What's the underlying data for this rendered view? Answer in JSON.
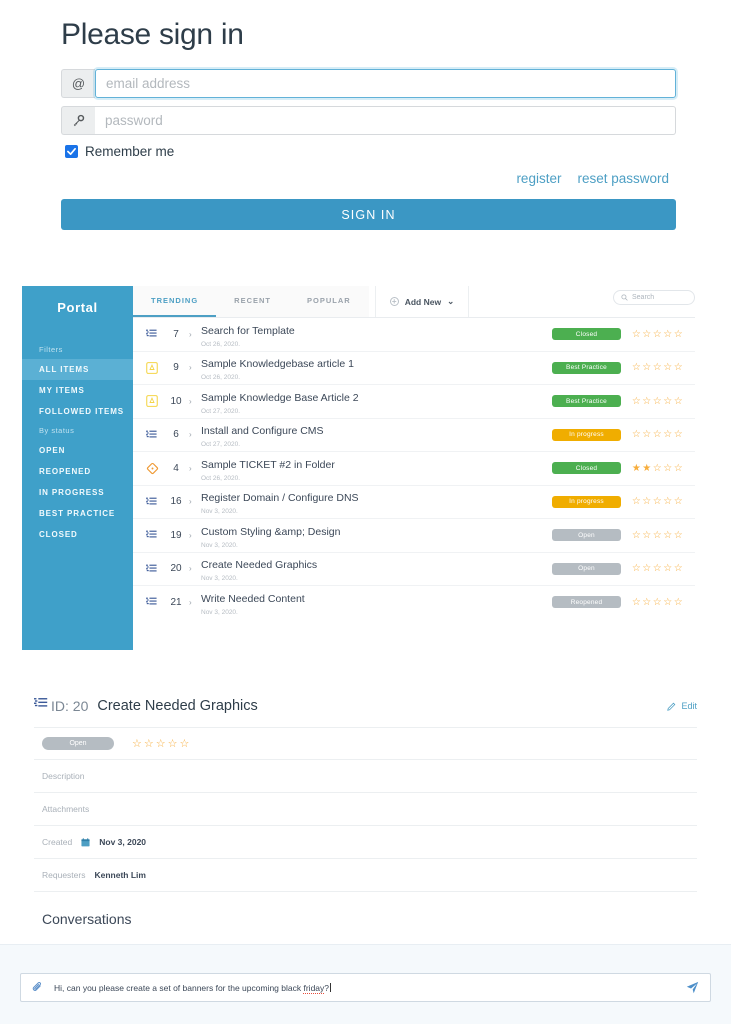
{
  "signin": {
    "title": "Please sign in",
    "email_placeholder": "email address",
    "email_value": "",
    "email_icon": "at-icon",
    "password_placeholder": "password",
    "password_value": "",
    "password_icon": "key-icon",
    "remember_label": "Remember me",
    "remember_checked": true,
    "register_link": "register",
    "reset_link": "reset password",
    "submit_label": "SIGN IN",
    "accent_color": "#3b97c4"
  },
  "portal": {
    "brand": "Portal",
    "sidebar_color": "#3fa0c9",
    "sidebar_active_color": "#5bb0d4",
    "groups": [
      {
        "label": "Filters",
        "items": [
          {
            "label": "ALL ITEMS",
            "active": true
          },
          {
            "label": "MY ITEMS",
            "active": false
          },
          {
            "label": "FOLLOWED ITEMS",
            "active": false
          }
        ]
      },
      {
        "label": "By status",
        "items": [
          {
            "label": "OPEN",
            "active": false
          },
          {
            "label": "REOPENED",
            "active": false
          },
          {
            "label": "IN PROGRESS",
            "active": false
          },
          {
            "label": "BEST PRACTICE",
            "active": false
          },
          {
            "label": "CLOSED",
            "active": false
          }
        ]
      }
    ],
    "tabs": [
      {
        "label": "TRENDING",
        "active": true
      },
      {
        "label": "RECENT",
        "active": false
      },
      {
        "label": "POPULAR",
        "active": false
      }
    ],
    "add_new_label": "Add New",
    "search_placeholder": "Search",
    "status_colors": {
      "Closed": "#4caf50",
      "Best Practice": "#4caf50",
      "In progress": "#f0ad00",
      "Open": "#b5bcc2",
      "Reopened": "#b5bcc2"
    },
    "rows": [
      {
        "icon": "task-list-icon",
        "id": "7",
        "title": "Search for Template",
        "date": "Oct 26, 2020.",
        "status": "Closed",
        "stars": 0
      },
      {
        "icon": "article-icon",
        "id": "9",
        "title": "Sample Knowledgebase article 1",
        "date": "Oct 26, 2020.",
        "status": "Best Practice",
        "stars": 0
      },
      {
        "icon": "article-icon",
        "id": "10",
        "title": "Sample Knowledge Base Article 2",
        "date": "Oct 27, 2020.",
        "status": "Best Practice",
        "stars": 0
      },
      {
        "icon": "task-list-icon",
        "id": "6",
        "title": "Install and Configure CMS",
        "date": "Oct 27, 2020.",
        "status": "In progress",
        "stars": 0
      },
      {
        "icon": "ticket-icon",
        "id": "4",
        "title": "Sample TICKET #2 in Folder",
        "date": "Oct 26, 2020.",
        "status": "Closed",
        "stars": 2
      },
      {
        "icon": "task-list-icon",
        "id": "16",
        "title": "Register Domain / Configure DNS",
        "date": "Nov 3, 2020.",
        "status": "In progress",
        "stars": 0
      },
      {
        "icon": "task-list-icon",
        "id": "19",
        "title": "Custom Styling &amp; Design",
        "date": "Nov 3, 2020.",
        "status": "Open",
        "stars": 0
      },
      {
        "icon": "task-list-icon",
        "id": "20",
        "title": "Create Needed Graphics",
        "date": "Nov 3, 2020.",
        "status": "Open",
        "stars": 0
      },
      {
        "icon": "task-list-icon",
        "id": "21",
        "title": "Write Needed Content",
        "date": "Nov 3, 2020.",
        "status": "Reopened",
        "stars": 0
      }
    ]
  },
  "detail": {
    "id_label": "ID: 20",
    "title": "Create Needed Graphics",
    "edit_label": "Edit",
    "status": "Open",
    "stars": 0,
    "description_label": "Description",
    "description_value": "",
    "attachments_label": "Attachments",
    "attachments_value": "",
    "created_label": "Created",
    "created_value": "Nov 3, 2020",
    "requesters_label": "Requesters",
    "requesters_value": "Kenneth Lim",
    "conversations_label": "Conversations",
    "message_prefix": "Hi, can you please create a set of banners for the upcoming black ",
    "message_misspelled": "friday",
    "message_suffix": "?",
    "send_icon": "send-paper-plane-icon",
    "attach_icon": "paperclip-icon"
  }
}
